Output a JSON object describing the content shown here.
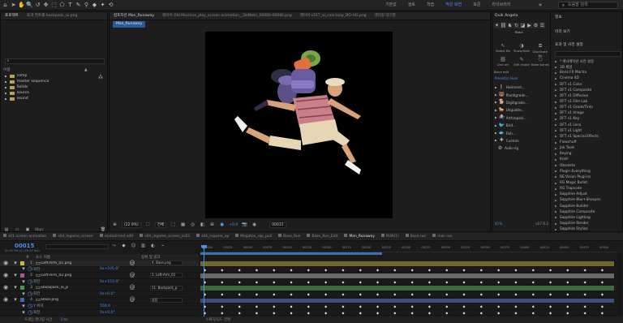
{
  "toolbar": {
    "tools": [
      "⌂",
      "➤",
      "✋",
      "🔍",
      "↺",
      "✥",
      "⬚",
      "⬠",
      "T",
      "✎",
      "⚲",
      "◆",
      "✦",
      "⟲"
    ],
    "workspaces": [
      {
        "label": "기본값",
        "active": false
      },
      {
        "label": "검토",
        "active": false
      },
      {
        "label": "학습",
        "active": false
      },
      {
        "label": "작은 화면",
        "active": true
      },
      {
        "label": "표준",
        "active": false
      },
      {
        "label": "라이브러리",
        "active": false
      }
    ],
    "search_placeholder": "도움말 검색"
  },
  "project": {
    "tabs": [
      {
        "label": "프로젝트",
        "active": true
      },
      {
        "label": "효과 컨트롤 backpack_ai.png",
        "active": false
      }
    ],
    "columns": {
      "name": "이름",
      "type": "▲"
    },
    "items": [
      {
        "label": "comp"
      },
      {
        "label": "master sequence"
      },
      {
        "label": "Solids"
      },
      {
        "label": "source"
      },
      {
        "label": "sound"
      }
    ],
    "bpc": "8bpc"
  },
  "comp": {
    "tabs": [
      {
        "label": "컴포지션 Man_Runaway",
        "active": true
      },
      {
        "label": "레이어 Old Machine_play_screen animation__DeMetri_00000-00040.png",
        "active": false
      },
      {
        "label": "레이어 s317_ai_coin-loop_DO-HG.png",
        "active": false
      },
      {
        "label": "렌더링 대기열",
        "active": false
      }
    ],
    "breadcrumb": "Man_Runaway",
    "zoom": "(22.9%)",
    "resolution": "전체",
    "timecode": "+0.0",
    "frame": "00015"
  },
  "duik": {
    "title": "Duik Angela",
    "section": "Bone",
    "buttons_a": [
      "Select Bo",
      "Show/hide",
      "Duplicate Bo"
    ],
    "buttons_b": [
      "Link art",
      "Edit mode",
      "Bake bones"
    ],
    "bone_edit": "Bone edit",
    "presets_label": "Preset(s) Hum",
    "presets": [
      "Humnoid...",
      "Plantigrade...",
      "Digitigrade...",
      "Ungulate...",
      "Arthropod...",
      "Bird...",
      "Fish...",
      "Custom",
      "Auto-rig"
    ],
    "zoom": "41%",
    "version": "v17.0.2"
  },
  "effects": {
    "info": "정보",
    "audio": "미리 보기",
    "title": "효과 및 사전 설정",
    "items": [
      "* 애니메이션 사전 설정",
      "3D 채널",
      "Boris FX Mocha",
      "Cinema 4D",
      "DFT v1 Color",
      "DFT v1 Composite",
      "DFT v1 Diffusion",
      "DFT v1 Film Lab",
      "DFT v1 Grads/Tints",
      "DFT v1 Image",
      "DFT v1 Key",
      "DFT v1 Lens",
      "DFT v1 Light",
      "DFT v1 Special Effects",
      "Flowchuff",
      "Jak Tools",
      "Keying",
      "Knoll",
      "Obsolete",
      "Plugin Everything",
      "RE:Vision Plug-ins",
      "RG Magic Bullet",
      "RG Trapcode",
      "Sapphire Adjust",
      "Sapphire Blur+Sharpen",
      "Sapphire Builder",
      "Sapphire Composite",
      "Sapphire Lighting",
      "Sapphire Render",
      "Sapphire Stylize"
    ]
  },
  "timeline": {
    "tabs": [
      {
        "label": "s01 screen animation",
        "active": false
      },
      {
        "label": "s04_ingame_screen",
        "active": false
      },
      {
        "label": "ekstaid test edit",
        "active": false
      },
      {
        "label": "s04_ingame_screen_sc03",
        "active": false
      },
      {
        "label": "s04_ingame_ap",
        "active": false
      },
      {
        "label": "Megaton_rap_pull",
        "active": false
      },
      {
        "label": "Base_Run",
        "active": false
      },
      {
        "label": "Base_Run_Edit",
        "active": false
      },
      {
        "label": "Man_Runaway",
        "active": true
      },
      {
        "label": "RUN(1)",
        "active": false
      },
      {
        "label": "Base run",
        "active": false
      },
      {
        "label": "man run",
        "active": false
      }
    ],
    "timecode": "00015",
    "fps": "00:00:00:15 (29.97 fps)",
    "headers": {
      "num": "#",
      "name": "소스 이름",
      "parent": "상위 및 링크"
    },
    "layers": [
      {
        "num": "1",
        "name": "Left-Arm_01.png",
        "color": "#d6b632",
        "parent": "4. Base.png",
        "bar": "#6f6a2c",
        "selected": true
      },
      {
        "num": "",
        "name": "회전",
        "value": "0x+105.0°",
        "sub": true
      },
      {
        "num": "2",
        "name": "Left-Arm_02.png",
        "color": "#b54f9a",
        "parent": "1. Left-Arm_01",
        "bar": "#686868",
        "selected": false
      },
      {
        "num": "",
        "name": "회전",
        "value": "0x+153.0°",
        "sub": true
      },
      {
        "num": "3",
        "name": "Backpack_ai_p",
        "color": "#3f9a4f",
        "parent": "11. Backpack_p",
        "bar": "#3c6a3c",
        "selected": false
      },
      {
        "num": "",
        "name": "회전",
        "value": "0x+0.0°",
        "sub": true
      },
      {
        "num": "4",
        "name": "Base.png",
        "color": "#3f69b9",
        "parent": "없음",
        "bar": "#3c4f7a",
        "selected": false
      },
      {
        "num": "",
        "name": "Y 위치",
        "value": "550.0",
        "sub": true
      },
      {
        "num": "",
        "name": "회전",
        "value": "0x+0.0°",
        "sub": true
      }
    ],
    "ruler": [
      "00000",
      "00025",
      "00050",
      "00075",
      "00100",
      "00125",
      "00150",
      "00175",
      "00200",
      "00225",
      "00250",
      "00275",
      "00300",
      "00325",
      "00350",
      "00375",
      "00400",
      "00425",
      "00450",
      "00475",
      "00500"
    ],
    "footer_left": "프레임 렌더링 시간",
    "footer_time": "1ms",
    "footer_right": "스위치/모드 전환"
  }
}
